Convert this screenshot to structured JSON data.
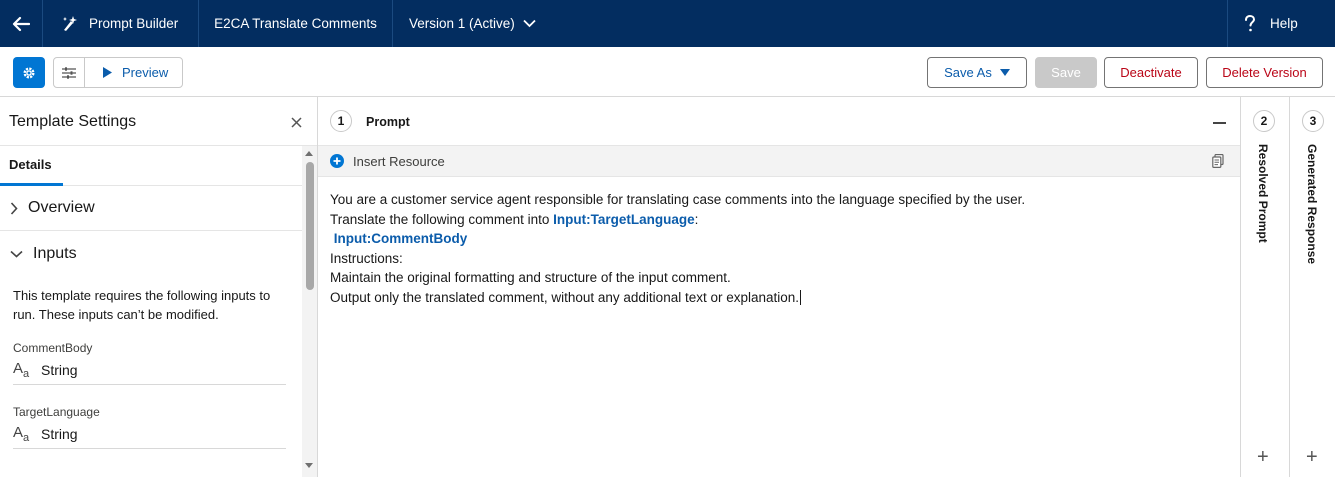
{
  "topbar": {
    "app_name": "Prompt Builder",
    "template_name": "E2CA Translate Comments",
    "version": "Version 1 (Active)",
    "help": "Help"
  },
  "toolbar": {
    "preview": "Preview",
    "save_as": "Save As",
    "save": "Save",
    "deactivate": "Deactivate",
    "delete_version": "Delete Version"
  },
  "left_panel": {
    "title": "Template Settings",
    "tab": "Details",
    "overview": "Overview",
    "inputs": "Inputs",
    "description": "This template requires the following inputs to run. These inputs can’t be modified.",
    "items": [
      {
        "name": "CommentBody",
        "type": "String"
      },
      {
        "name": "TargetLanguage",
        "type": "String"
      }
    ]
  },
  "prompt_panel": {
    "step": "1",
    "title": "Prompt",
    "insert_resource": "Insert Resource",
    "lines": {
      "l1": "You are a customer service agent responsible for translating case comments into the language specified by the user.",
      "l2a": "Translate the following comment into ",
      "l2_merge": "Input:TargetLanguage",
      "l2b": ":",
      "l3_merge": "Input:CommentBody",
      "l4": "Instructions:",
      "l5": "Maintain the original formatting and structure of the input comment.",
      "l6": "Output only the translated comment, without any additional text or explanation."
    }
  },
  "resolved_panel": {
    "step": "2",
    "title": "Resolved Prompt"
  },
  "response_panel": {
    "step": "3",
    "title": "Generated Response"
  },
  "colors": {
    "topbar_bg": "#032d60",
    "brand_blue": "#0176d3",
    "link_blue": "#0b5cab",
    "destructive_red": "#ba0517"
  }
}
